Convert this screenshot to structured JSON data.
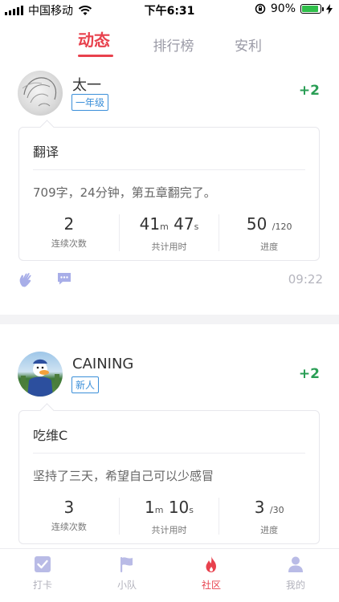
{
  "status_bar": {
    "carrier": "中国移动",
    "time": "下午6:31",
    "battery": "90%",
    "battery_level": 0.9
  },
  "tabs": [
    {
      "label": "动态",
      "active": true
    },
    {
      "label": "排行榜",
      "active": false
    },
    {
      "label": "安利",
      "active": false
    }
  ],
  "posts": [
    {
      "username": "太一",
      "badge": "一年级",
      "points": "+2",
      "title": "翻译",
      "text": "709字，24分钟，第五章翻完了。",
      "stats": [
        {
          "value": "2",
          "unit": "",
          "label": "连续次数"
        },
        {
          "value_min": "41",
          "unit_min": "m",
          "value_sec": "47",
          "unit_sec": "s",
          "label": "共计用时"
        },
        {
          "value": "50",
          "unit": "/120",
          "label": "进度"
        }
      ],
      "time": "09:22"
    },
    {
      "username": "CAINING",
      "badge": "新人",
      "points": "+2",
      "title": "吃维C",
      "text": "坚持了三天，希望自己可以少感冒",
      "stats": [
        {
          "value": "3",
          "unit": "",
          "label": "连续次数"
        },
        {
          "value_min": "1",
          "unit_min": "m",
          "value_sec": "10",
          "unit_sec": "s",
          "label": "共计用时"
        },
        {
          "value": "3",
          "unit": "/30",
          "label": "进度"
        }
      ]
    }
  ],
  "bottom_nav": [
    {
      "label": "打卡",
      "icon": "checkbox-icon",
      "active": false
    },
    {
      "label": "小队",
      "icon": "flag-icon",
      "active": false
    },
    {
      "label": "社区",
      "icon": "flame-icon",
      "active": true
    },
    {
      "label": "我的",
      "icon": "person-icon",
      "active": false
    }
  ],
  "colors": {
    "accent": "#e8414d",
    "points": "#2a9e55",
    "badge": "#3b8fd9",
    "battery": "#2fbf4a"
  }
}
